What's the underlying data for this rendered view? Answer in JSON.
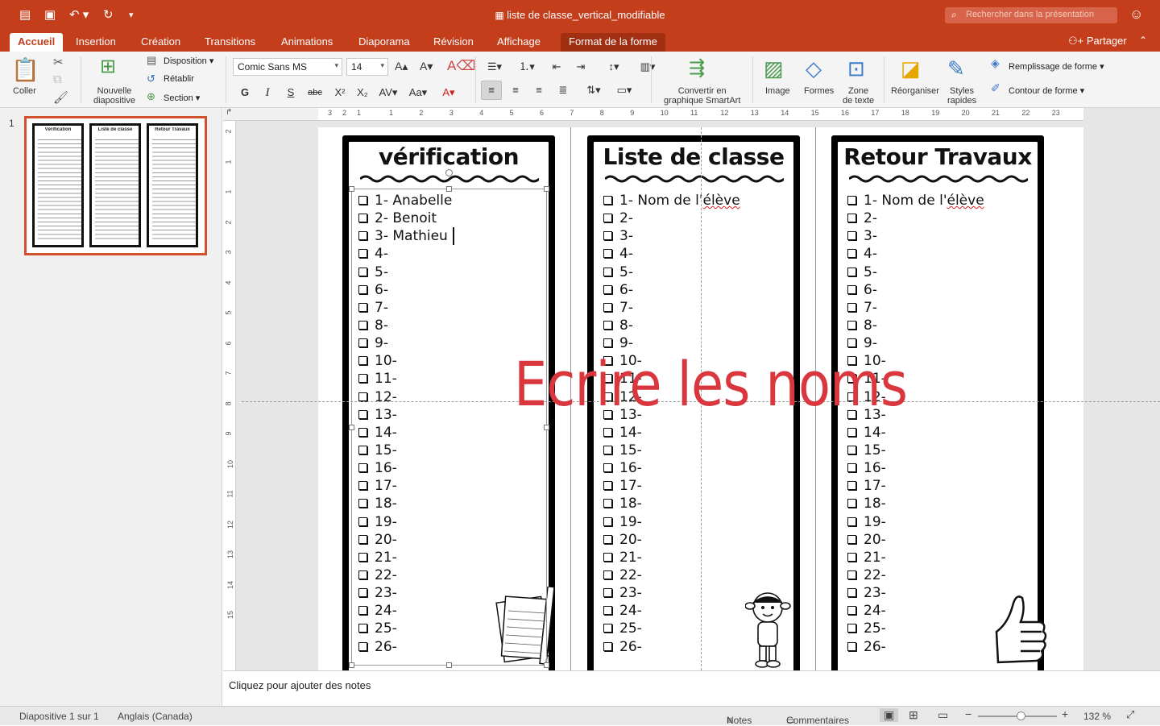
{
  "window": {
    "title": "liste de classe_vertical_modifiable",
    "search_placeholder": "Rechercher dans la présentation"
  },
  "tabs": [
    "Accueil",
    "Insertion",
    "Création",
    "Transitions",
    "Animations",
    "Diaporama",
    "Révision",
    "Affichage",
    "Format de la forme"
  ],
  "active_tab": "Accueil",
  "share_label": "Partager",
  "ribbon": {
    "paste": "Coller",
    "new_slide": [
      "Nouvelle",
      "diapositive"
    ],
    "layout": "Disposition",
    "reset": "Rétablir",
    "section": "Section",
    "font_name": "Comic Sans MS",
    "font_size": "14",
    "smartart": [
      "Convertir en",
      "graphique SmartArt"
    ],
    "image": "Image",
    "shapes": "Formes",
    "textbox": [
      "Zone",
      "de texte"
    ],
    "arrange": "Réorganiser",
    "quick_styles": [
      "Styles",
      "rapides"
    ],
    "shape_fill": "Remplissage de forme",
    "shape_outline": "Contour de forme",
    "bold": "G",
    "italic": "I",
    "underline": "S",
    "strike": "abc"
  },
  "thumbnail": {
    "number": "1",
    "titles": [
      "Vérification",
      "Liste de classe",
      "Retour Travaux"
    ]
  },
  "slide": {
    "cards": [
      {
        "title": "vérification",
        "items": [
          "1- Anabelle",
          "2- Benoit",
          "3- Mathieu",
          "4-",
          "5-",
          "6-",
          "7-",
          "8-",
          "9-",
          "10-",
          "11-",
          "12-",
          "13-",
          "14-",
          "15-",
          "16-",
          "17-",
          "18-",
          "19-",
          "20-",
          "21-",
          "22-",
          "23-",
          "24-",
          "25-",
          "26-"
        ]
      },
      {
        "title": "Liste de classe",
        "items": [
          "1- Nom de l'élève",
          "2-",
          "3-",
          "4-",
          "5-",
          "6-",
          "7-",
          "8-",
          "9-",
          "10-",
          "11-",
          "12-",
          "13-",
          "14-",
          "15-",
          "16-",
          "17-",
          "18-",
          "19-",
          "20-",
          "21-",
          "22-",
          "23-",
          "24-",
          "25-",
          "26-"
        ]
      },
      {
        "title": "Retour Travaux",
        "items": [
          "1- Nom de l'élève",
          "2-",
          "3-",
          "4-",
          "5-",
          "6-",
          "7-",
          "8-",
          "9-",
          "10-",
          "11-",
          "12-",
          "13-",
          "14-",
          "15-",
          "16-",
          "17-",
          "18-",
          "19-",
          "20-",
          "21-",
          "22-",
          "23-",
          "24-",
          "25-",
          "26-"
        ]
      }
    ],
    "overlay_text": "Ecrire les noms"
  },
  "notes_placeholder": "Cliquez pour ajouter des notes",
  "status": {
    "slide_info": "Diapositive 1 sur 1",
    "language": "Anglais (Canada)",
    "notes": "Notes",
    "comments": "Commentaires",
    "zoom": "132 %"
  },
  "ruler": {
    "h_ticks": [
      "3",
      "2",
      "1",
      "1",
      "2",
      "3",
      "4",
      "5",
      "6",
      "7",
      "8",
      "9",
      "10",
      "11",
      "12",
      "13",
      "14",
      "15",
      "16",
      "17",
      "18",
      "19",
      "20",
      "21",
      "22",
      "23"
    ],
    "v_ticks": [
      "2",
      "1",
      "1",
      "2",
      "3",
      "4",
      "5",
      "6",
      "7",
      "8",
      "9",
      "10",
      "11",
      "12",
      "13",
      "14",
      "15"
    ]
  },
  "colors": {
    "accent": "#c43e1c",
    "overlay": "#d9363e"
  }
}
